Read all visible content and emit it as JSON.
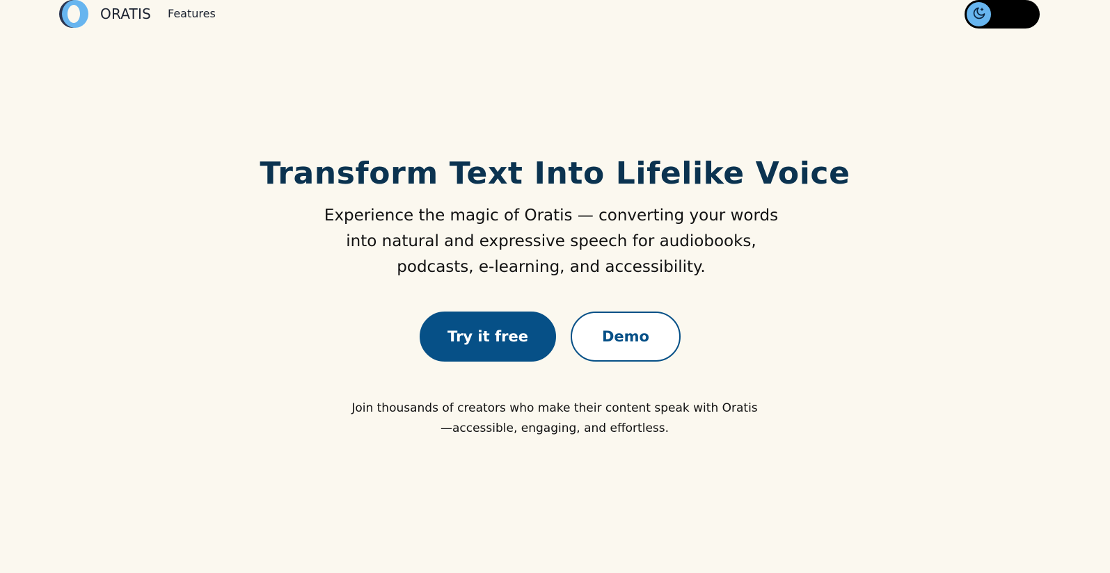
{
  "nav": {
    "brand": "ORATIS",
    "links": [
      {
        "label": "Features"
      }
    ],
    "theme_toggle": {
      "icon": "moon-icon",
      "knob_color": "#67b5ef"
    }
  },
  "hero": {
    "title": "Transform Text Into Lifelike Voice",
    "subtitle": "Experience the magic of Oratis — converting your words into natural and expressive speech for audiobooks, podcasts, e-learning, and accessibility.",
    "primary_cta": "Try it free",
    "secondary_cta": "Demo",
    "tagline": "Join thousands of creators who make their content speak with Oratis—accessible, engaging, and effortless."
  },
  "colors": {
    "background": "#fbf8ef",
    "title": "#0b3350",
    "accent": "#065087",
    "logo_light": "#67b5ef",
    "logo_dark": "#2b3550"
  }
}
